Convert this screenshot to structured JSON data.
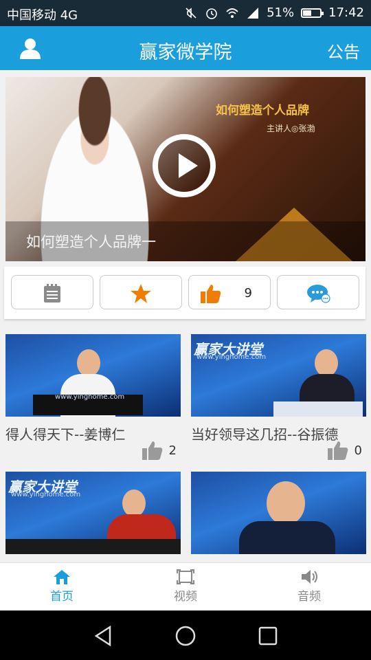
{
  "status_bar": {
    "carrier": "中国移动 4G",
    "battery_percent": "51%",
    "battery_level": 0.51,
    "time": "17:42",
    "icons": [
      "mute-icon",
      "alarm-icon",
      "wifi-icon",
      "signal-icon",
      "battery-icon"
    ]
  },
  "header": {
    "title": "赢家微学院",
    "notice_label": "公告",
    "user_icon": "user-icon"
  },
  "hero": {
    "caption": "如何塑造个人品牌一",
    "poster_title": "如何塑造个人品牌",
    "poster_sub": "主讲人◎张渤"
  },
  "actions": {
    "like_count": "9",
    "icons": [
      "notes-icon",
      "star-icon",
      "thumbs-up-icon",
      "comment-icon"
    ]
  },
  "videos": [
    {
      "title": "得人得天下--姜博仁",
      "likes": "2"
    },
    {
      "title": "当好领导这几招--谷振德",
      "likes": "0"
    },
    {
      "title": "",
      "likes": "",
      "brand": "赢家大讲堂",
      "url": "www.yinghome.com"
    },
    {
      "title": "",
      "likes": ""
    }
  ],
  "thumb_texts": {
    "brand": "赢家大讲堂",
    "url": "www.yinghome.com",
    "url_small": "www.yinghome.com"
  },
  "tabbar": {
    "tabs": [
      {
        "label": "首页",
        "icon": "home-icon",
        "active": true
      },
      {
        "label": "视频",
        "icon": "video-frame-icon",
        "active": false
      },
      {
        "label": "音频",
        "icon": "speaker-icon",
        "active": false
      }
    ]
  },
  "colors": {
    "primary": "#1a9fdc",
    "status_bar": "#1a2b38",
    "accent_orange": "#f07d00",
    "comment_blue": "#2a9ad8"
  }
}
